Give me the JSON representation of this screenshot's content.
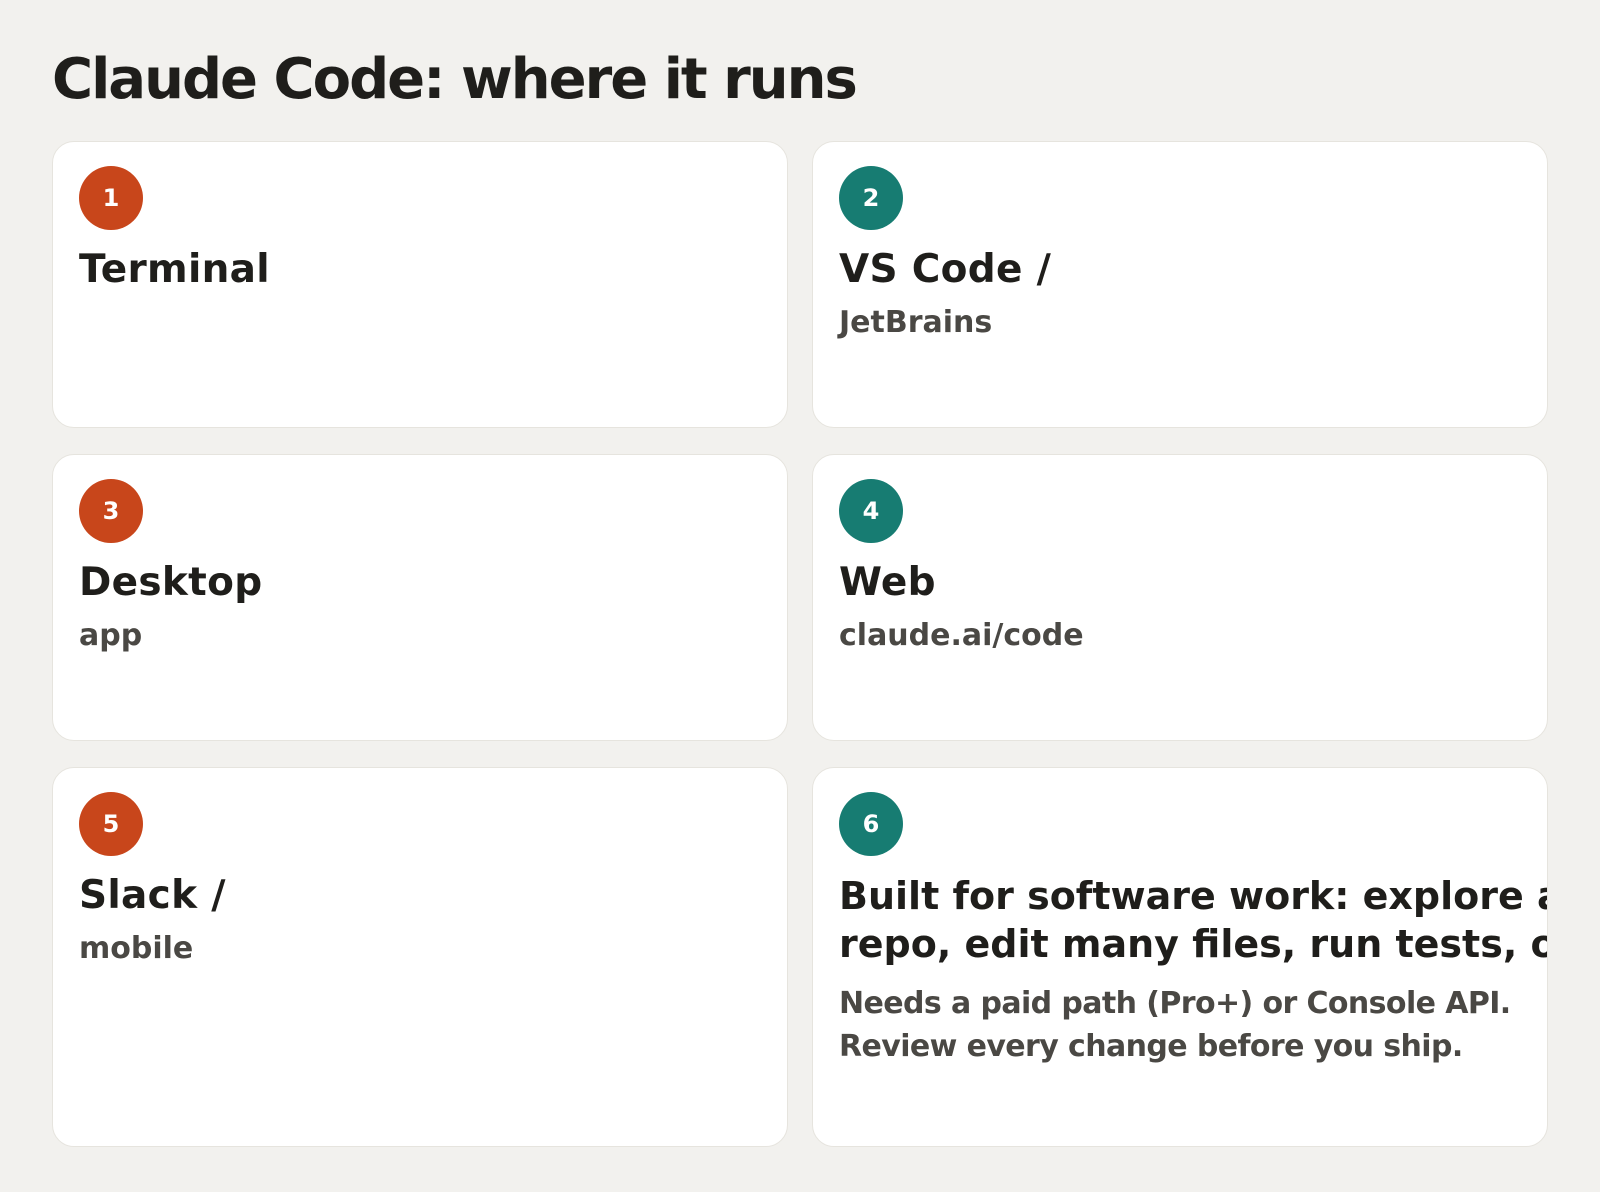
{
  "page": {
    "title": "Claude Code: where it runs"
  },
  "cards": [
    {
      "number": "1",
      "badge_color": "#c8461b",
      "title_lines": [
        "Terminal"
      ],
      "subtitle": ""
    },
    {
      "number": "2",
      "badge_color": "#177c72",
      "title_lines": [
        "VS Code /"
      ],
      "subtitle": "JetBrains"
    },
    {
      "number": "3",
      "badge_color": "#c8461b",
      "title_lines": [
        "Desktop"
      ],
      "subtitle": "app"
    },
    {
      "number": "4",
      "badge_color": "#177c72",
      "title_lines": [
        "Web"
      ],
      "subtitle": "claude.ai/code"
    },
    {
      "number": "5",
      "badge_color": "#c8461b",
      "title_lines": [
        "Slack /"
      ],
      "subtitle": "mobile"
    },
    {
      "number": "6",
      "badge_color": "#177c72",
      "title_lines": [
        "Built for software work: explore a",
        "repo, edit many files, run tests, o"
      ],
      "description_lines": [
        "Needs a paid path (Pro+) or Console API.",
        "Review every change before you ship."
      ]
    }
  ],
  "colors": {
    "background": "#f2f1ee",
    "card": "#ffffff",
    "orange_accent": "#c8461b",
    "teal_accent": "#177c72"
  }
}
